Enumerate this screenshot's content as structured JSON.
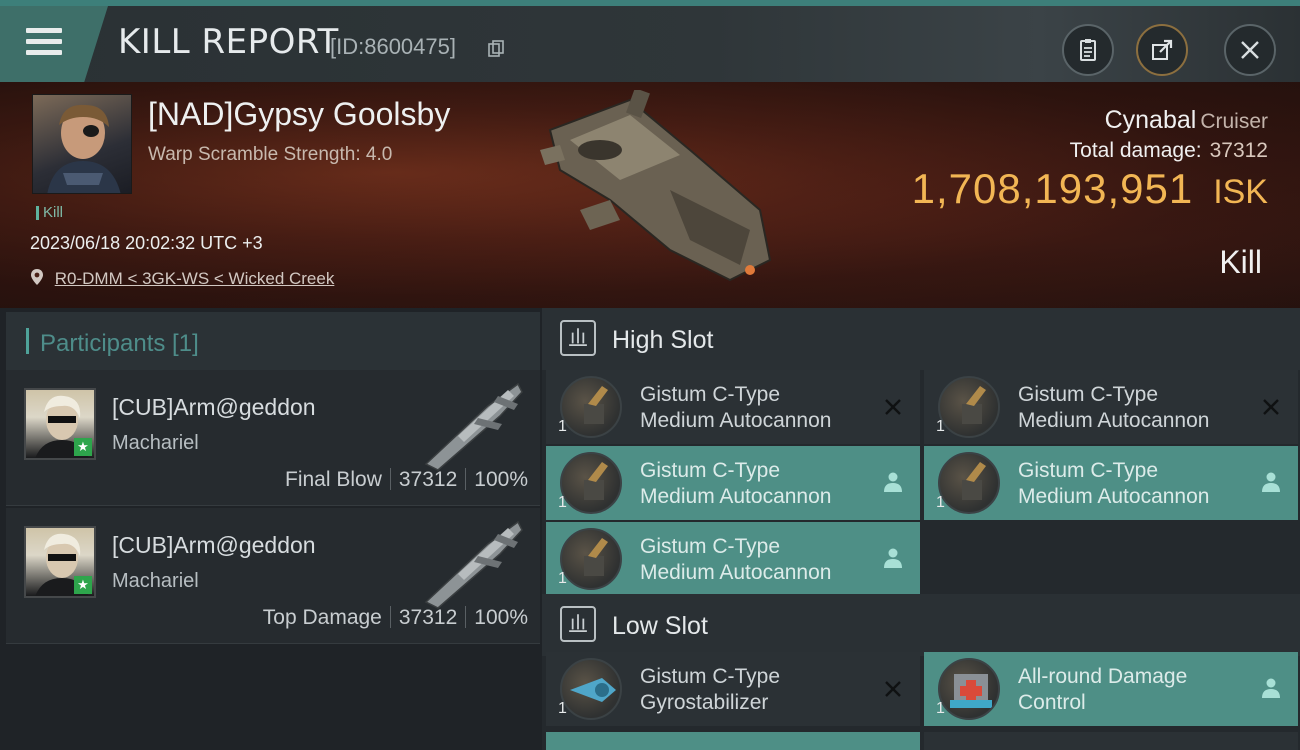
{
  "header": {
    "title": "KILL REPORT",
    "id_label": "[ID:8600475]"
  },
  "victim": {
    "name": "[NAD]Gypsy Goolsby",
    "warp_scramble": "Warp Scramble Strength: 4.0",
    "kill_tag": "Kill",
    "datetime": "2023/06/18 20:02:32 UTC +3",
    "location": "R0-DMM < 3GK-WS < Wicked Creek",
    "ship_name": "Cynabal",
    "ship_class": "Cruiser",
    "total_damage_label": "Total damage:",
    "total_damage": "37312",
    "isk_value": "1,708,193,951",
    "isk_unit": "ISK",
    "result": "Kill"
  },
  "participants": {
    "header": "Participants [1]",
    "rows": [
      {
        "name": "[CUB]Arm@geddon",
        "ship": "Machariel",
        "role": "Final Blow",
        "damage": "37312",
        "percent": "100%"
      },
      {
        "name": "[CUB]Arm@geddon",
        "ship": "Machariel",
        "role": "Top Damage",
        "damage": "37312",
        "percent": "100%"
      }
    ]
  },
  "slots": {
    "high_title": "High Slot",
    "low_title": "Low Slot",
    "high": [
      {
        "line1": "Gistum C-Type",
        "line2": "Medium Autocannon",
        "qty": "1",
        "status": "destroyed"
      },
      {
        "line1": "Gistum C-Type",
        "line2": "Medium Autocannon",
        "qty": "1",
        "status": "destroyed"
      },
      {
        "line1": "Gistum C-Type",
        "line2": "Medium Autocannon",
        "qty": "1",
        "status": "dropped"
      },
      {
        "line1": "Gistum C-Type",
        "line2": "Medium Autocannon",
        "qty": "1",
        "status": "dropped"
      },
      {
        "line1": "Gistum C-Type",
        "line2": "Medium Autocannon",
        "qty": "1",
        "status": "dropped"
      }
    ],
    "low": [
      {
        "line1": "Gistum C-Type",
        "line2": "Gyrostabilizer",
        "qty": "1",
        "status": "destroyed"
      },
      {
        "line1": "All-round Damage",
        "line2": "Control",
        "qty": "1",
        "status": "dropped"
      }
    ]
  },
  "icons": {
    "menu": "menu-icon",
    "copy": "copy-icon",
    "clipboard": "clipboard-icon",
    "share": "share-icon",
    "close": "close-icon",
    "location": "location-pin-icon",
    "slot": "slot-icon",
    "destroyed": "x-icon",
    "dropped": "person-icon"
  },
  "colors": {
    "accent": "#4e8f86",
    "isk": "#f2b654",
    "kill_tag": "#7fbba8"
  }
}
